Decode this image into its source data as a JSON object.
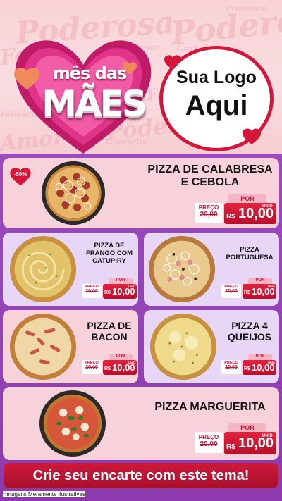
{
  "header": {
    "background_words": [
      "Poderosa",
      "Poderosa",
      "Protetora",
      "Feliz",
      "Amor",
      "Felicidade",
      "Carinho",
      "Guerreira",
      "Amor",
      "Poderosa",
      "Feliz"
    ],
    "campaign_line1": "mês das",
    "campaign_line2": "MÃES",
    "logo_line1": "Sua Logo",
    "logo_line2": "Aqui"
  },
  "products": [
    {
      "name_lines": [
        "PIZZA DE CALABRESA",
        "E CEBOLA"
      ],
      "badge": "-50%",
      "por_label": "POR",
      "old_label": "PREÇO",
      "old_price": "20,00",
      "currency": "R$",
      "price": "10,00",
      "unit": "UNID"
    },
    {
      "name_lines": [
        "PIZZA DE",
        "FRANGO COM",
        "CATUPIRY"
      ],
      "por_label": "POR",
      "old_label": "PREÇO",
      "old_price": "20,00",
      "currency": "R$",
      "price": "10,00",
      "unit": "UNID"
    },
    {
      "name_lines": [
        "PIZZA",
        "PORTUGUESA"
      ],
      "por_label": "POR",
      "old_label": "PREÇO",
      "old_price": "20,00",
      "currency": "R$",
      "price": "10,00",
      "unit": "UNID"
    },
    {
      "name_lines": [
        "PIZZA DE",
        "BACON"
      ],
      "por_label": "POR",
      "old_label": "PREÇO",
      "old_price": "20,00",
      "currency": "R$",
      "price": "10,00",
      "unit": "UNID"
    },
    {
      "name_lines": [
        "PIZZA 4",
        "QUEIJOS"
      ],
      "por_label": "POR",
      "old_label": "PREÇO",
      "old_price": "20,00",
      "currency": "R$",
      "price": "10,00",
      "unit": "UNID"
    },
    {
      "name_lines": [
        "PIZZA MARGUERITA"
      ],
      "por_label": "POR",
      "old_label": "PREÇO",
      "old_price": "20,00",
      "currency": "R$",
      "price": "10,00",
      "unit": "UNID"
    }
  ],
  "cta": {
    "label": "Crie seu encarte com este tema!"
  },
  "footnote": "*Imagens Meramente Ilustrativas",
  "colors": {
    "accent_red": "#d3163a",
    "panel_purple": "#9b4bbd",
    "card_pink": "#f7d2da",
    "card_lavender": "#e7d6f6"
  }
}
